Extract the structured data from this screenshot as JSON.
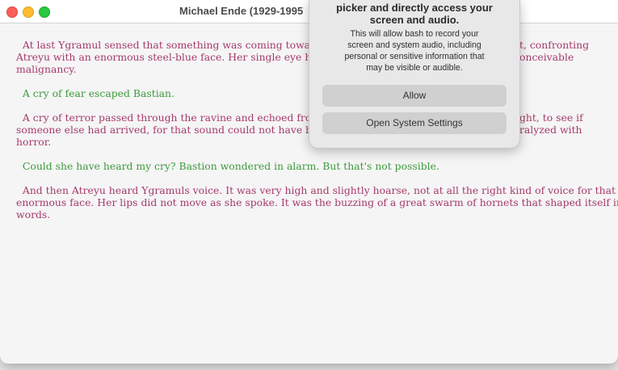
{
  "window": {
    "title": "Michael Ende (1929-1995"
  },
  "paragraphs": [
    {
      "color": "#a53a6b",
      "lines": [
        {
          "left": "  At last Ygramul sensed that something was coming toward her",
          "right": "t, confronting"
        },
        {
          "left": "Atreyu with an enormous steel-blue face. Her single eye had a v",
          "right": "onceivable"
        },
        {
          "left": "malignancy.",
          "right": ""
        }
      ]
    },
    {
      "color": "#3c9a3c",
      "lines": [
        {
          "left": "  A cry of fear escaped Bastian.",
          "right": ""
        }
      ]
    },
    {
      "color": "#a53a6b",
      "lines": [
        {
          "left": "  A cry of terror passed through the ravine and echoed from side",
          "right": "ght, to see if"
        },
        {
          "left": "someone else had arrived, for that sound could not have been m",
          "right": "ralyzed with"
        },
        {
          "left": "horror.",
          "right": ""
        }
      ]
    },
    {
      "color": "#3c9a3c",
      "lines": [
        {
          "left": "  Could she have heard my cry? Bastion wondered in alarm. But that's not possible.",
          "right": ""
        }
      ]
    },
    {
      "color": "#a53a6b",
      "lines": [
        {
          "left": "  And then Atreyu heard Ygramuls voice. It was very high and slightly hoarse, not at all the right kind of voice for that",
          "right": ""
        },
        {
          "left": "enormous face. Her lips did not move as she spoke. It was the buzzing of a great swarm of hornets that shaped itself into",
          "right": ""
        },
        {
          "left": "words.",
          "right": ""
        }
      ]
    }
  ],
  "dialog": {
    "title_lines": [
      "picker and directly access your",
      "screen and audio."
    ],
    "body_lines": [
      "This will allow bash to record your",
      "screen and system audio, including",
      "personal or sensitive information that",
      "may be visible or audible."
    ],
    "allow_label": "Allow",
    "settings_label": "Open System Settings"
  }
}
